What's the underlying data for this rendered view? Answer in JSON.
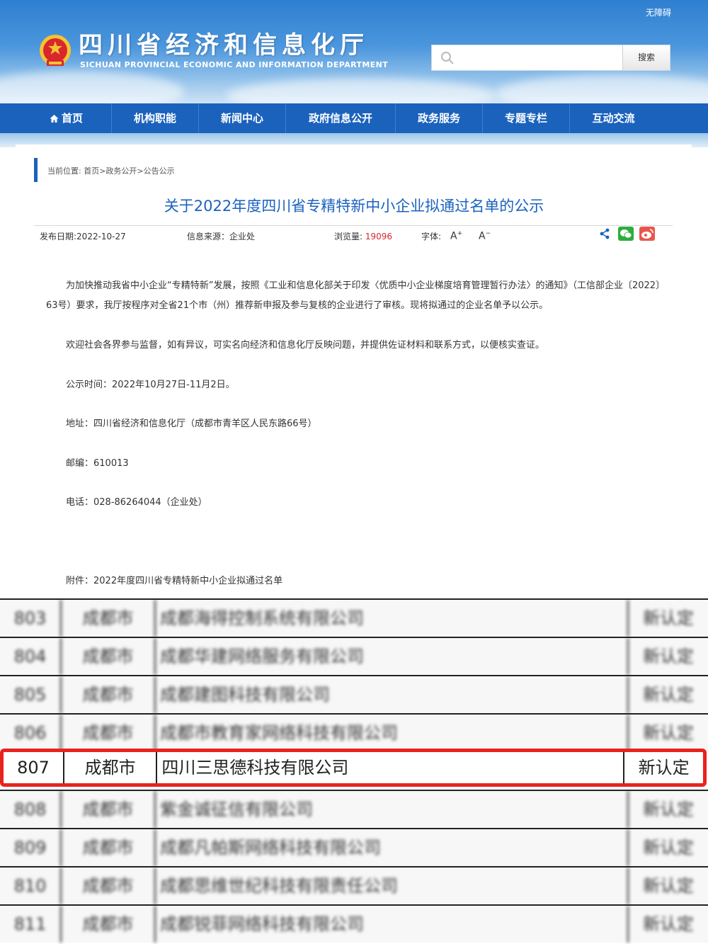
{
  "header": {
    "accessibility": "无障碍",
    "site_title": "四川省经济和信息化厅",
    "site_subtitle": "SICHUAN PROVINCIAL ECONOMIC AND INFORMATION DEPARTMENT",
    "search_placeholder": "",
    "search_button": "搜索"
  },
  "nav": {
    "items": [
      {
        "label": "首页",
        "icon": "home-icon"
      },
      {
        "label": "机构职能"
      },
      {
        "label": "新闻中心"
      },
      {
        "label": "政府信息公开"
      },
      {
        "label": "政务服务"
      },
      {
        "label": "专题专栏"
      },
      {
        "label": "互动交流"
      }
    ]
  },
  "breadcrumb": "当前位置: 首页>政务公开>公告公示",
  "article": {
    "title": "关于2022年度四川省专精特新中小企业拟通过名单的公示",
    "publish_date": "发布日期:2022-10-27",
    "source": "信息来源：企业处",
    "views_label": "浏览量:",
    "views": "19096",
    "font_label": "字体:",
    "font_increase": "A",
    "font_decrease": "A",
    "paragraphs": [
      "为加快推动我省中小企业“专精特新”发展，按照《工业和信息化部关于印发〈优质中小企业梯度培育管理暂行办法〉的通知》（工信部企业〔2022〕63号）要求，我厅按程序对全省21个市（州）推荐新申报及参与复核的企业进行了审核。现将拟通过的企业名单予以公示。",
      "欢迎社会各界参与监督，如有异议，可实名向经济和信息化厅反映问题，并提供佐证材料和联系方式，以便核实查证。",
      "公示时间：2022年10月27日-11月2日。",
      "地址：四川省经济和信息化厅（成都市青羊区人民东路66号）",
      "邮编：610013",
      "电话：028-86264044（企业处）",
      "附件：2022年度四川省专精特新中小企业拟通过名单"
    ]
  },
  "table": {
    "rows": [
      {
        "no": "803",
        "city": "成都市",
        "company": "成都海得控制系统有限公司",
        "status": "新认定",
        "blurred": true
      },
      {
        "no": "804",
        "city": "成都市",
        "company": "成都华建网络服务有限公司",
        "status": "新认定",
        "blurred": true
      },
      {
        "no": "805",
        "city": "成都市",
        "company": "成都建图科技有限公司",
        "status": "新认定",
        "blurred": true
      },
      {
        "no": "806",
        "city": "成都市",
        "company": "成都市教育家网络科技有限公司",
        "status": "新认定",
        "blurred": true
      },
      {
        "no": "807",
        "city": "成都市",
        "company": "四川三思德科技有限公司",
        "status": "新认定",
        "blurred": false
      },
      {
        "no": "808",
        "city": "成都市",
        "company": "紫金诚征信有限公司",
        "status": "新认定",
        "blurred": true
      },
      {
        "no": "809",
        "city": "成都市",
        "company": "成都凡帕斯网络科技有限公司",
        "status": "新认定",
        "blurred": true
      },
      {
        "no": "810",
        "city": "成都市",
        "company": "成都思维世纪科技有限责任公司",
        "status": "新认定",
        "blurred": true
      },
      {
        "no": "811",
        "city": "成都市",
        "company": "成都锐菲网络科技有限公司",
        "status": "新认定",
        "blurred": true
      }
    ]
  },
  "colors": {
    "nav_bg": "#1b62bd",
    "title_blue": "#1b62bd",
    "views_red": "#d9272d",
    "highlight_red": "#e8231e"
  }
}
